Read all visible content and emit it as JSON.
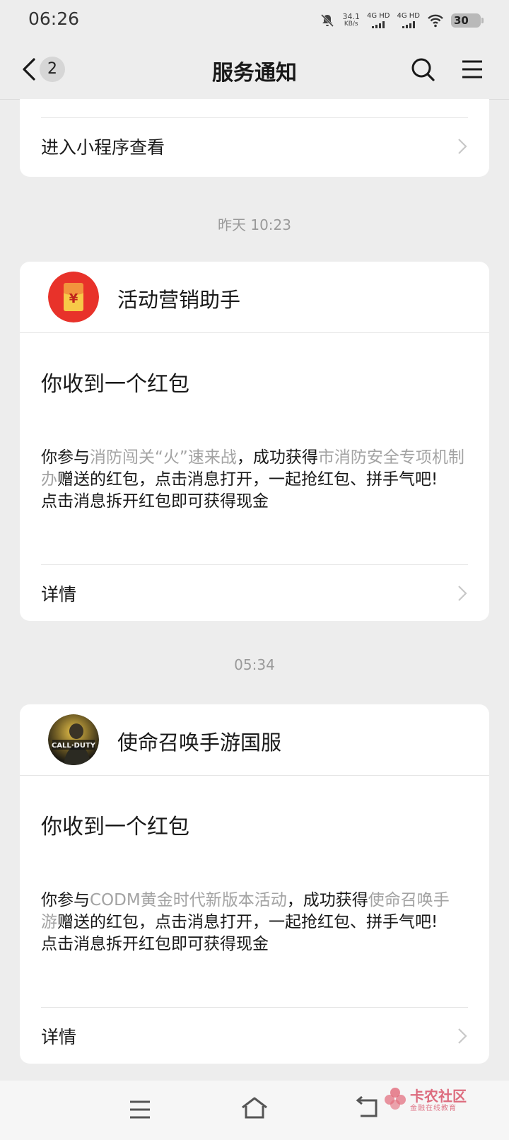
{
  "status_bar": {
    "time": "06:26",
    "net_speed_value": "34.1",
    "net_speed_unit": "KB/s",
    "sim1_label": "4G HD",
    "sim2_label": "4G HD",
    "battery": "30"
  },
  "header": {
    "badge_count": "2",
    "title": "服务通知"
  },
  "top_card": {
    "link_label": "进入小程序查看"
  },
  "messages": [
    {
      "timestamp": "昨天 10:23",
      "app_name": "活动营销助手",
      "title": "你收到一个红包",
      "body_prefix": "你参与",
      "activity": "消防闯关“火”速来战",
      "body_mid": "，成功获得",
      "sender": "市消防安全专项机制办",
      "body_suffix": "赠送的红包，点击消息打开，一起抢红包、拼手气吧!",
      "body_line2": "点击消息拆开红包即可获得现金",
      "details_label": "详情"
    },
    {
      "timestamp": "05:34",
      "app_name": "使命召唤手游国服",
      "title": "你收到一个红包",
      "body_prefix": "你参与",
      "activity": "CODM黄金时代新版本活动",
      "body_mid": "，成功获得",
      "sender": "使命召唤手游",
      "body_suffix": "赠送的红包，点击消息打开，一起抢红包、拼手气吧!",
      "body_line2": "点击消息拆开红包即可获得现金",
      "details_label": "详情"
    }
  ],
  "bottom_nav": {
    "watermark_title": "卡农社区",
    "watermark_subtitle": "金融在线教育"
  },
  "colors": {
    "background": "#ededed",
    "card": "#ffffff",
    "link_gray": "#a3a3a3",
    "red_packet": "#e8322a"
  }
}
